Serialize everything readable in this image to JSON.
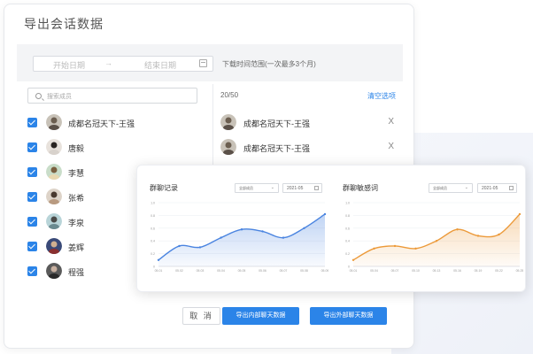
{
  "dialog": {
    "title": "导出会话数据"
  },
  "date_range": {
    "start_placeholder": "开始日期",
    "separator": "→",
    "end_placeholder": "结束日期",
    "hint": "下载时间范围(一次最多3个月)"
  },
  "search": {
    "placeholder": "搜索成员"
  },
  "members": [
    {
      "name": "成都名冠天下-王强"
    },
    {
      "name": "唐毅"
    },
    {
      "name": "李慧"
    },
    {
      "name": "张希"
    },
    {
      "name": "李泉"
    },
    {
      "name": "姜辉"
    },
    {
      "name": "程强"
    }
  ],
  "selected_panel": {
    "count": "20/50",
    "clear_label": "清空选项",
    "items": [
      {
        "name": "成都名冠天下-王强"
      },
      {
        "name": "成都名冠天下-王强"
      }
    ]
  },
  "buttons": {
    "cancel": "取 消",
    "export_internal": "导出内部聊天数据",
    "export_external": "导出外部聊天数据"
  },
  "charts": [
    {
      "title": "群聊记录",
      "select_value": "全部成员",
      "date_value": "2021-05",
      "color": "#4a84e0"
    },
    {
      "title": "群聊敏感词",
      "select_value": "全部成员",
      "date_value": "2021-05",
      "color": "#ec9a3a"
    }
  ],
  "chart_data": [
    {
      "type": "area",
      "title": "群聊记录",
      "x": [
        "05.01",
        "05.02",
        "05.03",
        "05.04",
        "05.05",
        "05.06",
        "05.07",
        "05.08",
        "05.09"
      ],
      "y_ticks": [
        "0",
        "0.2",
        "0.4",
        "0.6",
        "0.8",
        "1.0"
      ],
      "ylim": [
        0,
        1.0
      ],
      "values": [
        0.1,
        0.32,
        0.3,
        0.45,
        0.58,
        0.55,
        0.45,
        0.6,
        0.82
      ]
    },
    {
      "type": "area",
      "title": "群聊敏感词",
      "x": [
        "05.01",
        "05.04",
        "05.07",
        "05.10",
        "05.13",
        "05.16",
        "05.19",
        "05.22",
        "05.25"
      ],
      "y_ticks": [
        "0",
        "0.2",
        "0.4",
        "0.6",
        "0.8",
        "1.0"
      ],
      "ylim": [
        0,
        1.0
      ],
      "values": [
        0.1,
        0.28,
        0.32,
        0.28,
        0.4,
        0.58,
        0.48,
        0.5,
        0.82
      ]
    }
  ]
}
